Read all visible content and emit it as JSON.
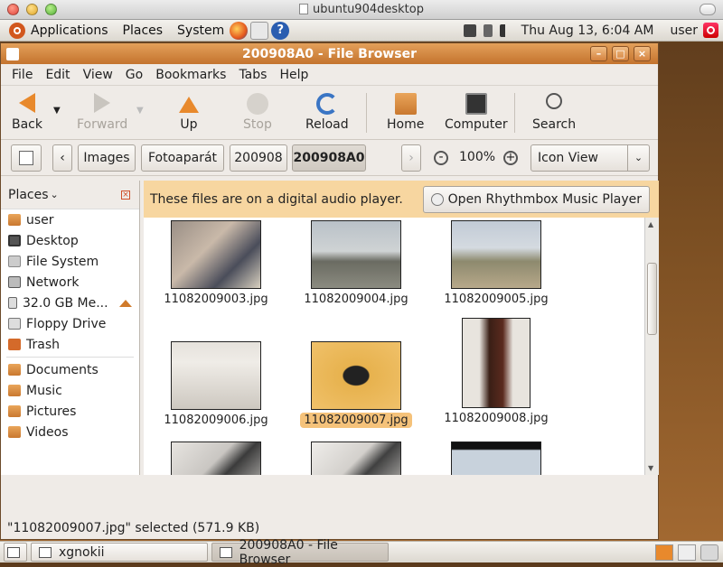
{
  "mac_window": {
    "title": "ubuntu904desktop"
  },
  "top_panel": {
    "menus": [
      "Applications",
      "Places",
      "System"
    ],
    "clock": "Thu Aug 13,  6:04 AM",
    "user": "user"
  },
  "window": {
    "title": "200908A0 - File Browser",
    "menubar": [
      "File",
      "Edit",
      "View",
      "Go",
      "Bookmarks",
      "Tabs",
      "Help"
    ],
    "toolbar": {
      "back": "Back",
      "forward": "Forward",
      "up": "Up",
      "stop": "Stop",
      "reload": "Reload",
      "home": "Home",
      "computer": "Computer",
      "search": "Search"
    },
    "path": [
      "Images",
      "Fotoaparát",
      "200908",
      "200908A0"
    ],
    "zoom": "100%",
    "view_mode": "Icon View",
    "sidebar": {
      "header": "Places",
      "items": [
        {
          "label": "user",
          "icon": "home-folder-icon"
        },
        {
          "label": "Desktop",
          "icon": "desktop-icon"
        },
        {
          "label": "File System",
          "icon": "filesystem-icon"
        },
        {
          "label": "Network",
          "icon": "network-icon"
        },
        {
          "label": "32.0 GB Me...",
          "icon": "media-card-icon"
        },
        {
          "label": "Floppy Drive",
          "icon": "floppy-icon"
        },
        {
          "label": "Trash",
          "icon": "trash-icon"
        }
      ],
      "bookmarks": [
        {
          "label": "Documents",
          "icon": "folder-icon"
        },
        {
          "label": "Music",
          "icon": "folder-icon"
        },
        {
          "label": "Pictures",
          "icon": "folder-icon"
        },
        {
          "label": "Videos",
          "icon": "folder-icon"
        }
      ]
    },
    "infobar": {
      "message": "These files are on a digital audio player.",
      "button": "Open Rhythmbox Music Player"
    },
    "files": [
      {
        "name": "11082009003.jpg",
        "selected": false
      },
      {
        "name": "11082009004.jpg",
        "selected": false
      },
      {
        "name": "11082009005.jpg",
        "selected": false
      },
      {
        "name": "11082009006.jpg",
        "selected": false
      },
      {
        "name": "11082009007.jpg",
        "selected": true
      },
      {
        "name": "11082009008.jpg",
        "selected": false
      },
      {
        "name": "",
        "selected": false
      },
      {
        "name": "",
        "selected": false
      },
      {
        "name": "",
        "selected": false
      }
    ],
    "status": "\"11082009007.jpg\" selected (571.9 KB)"
  },
  "bottom_panel": {
    "tasks": [
      {
        "label": "xgnokii",
        "active": false
      },
      {
        "label": "200908A0 - File Browser",
        "active": true
      }
    ]
  },
  "colors": {
    "accent": "#c9782f",
    "infobar": "#f7d6a0",
    "selection": "#f5c27a"
  }
}
